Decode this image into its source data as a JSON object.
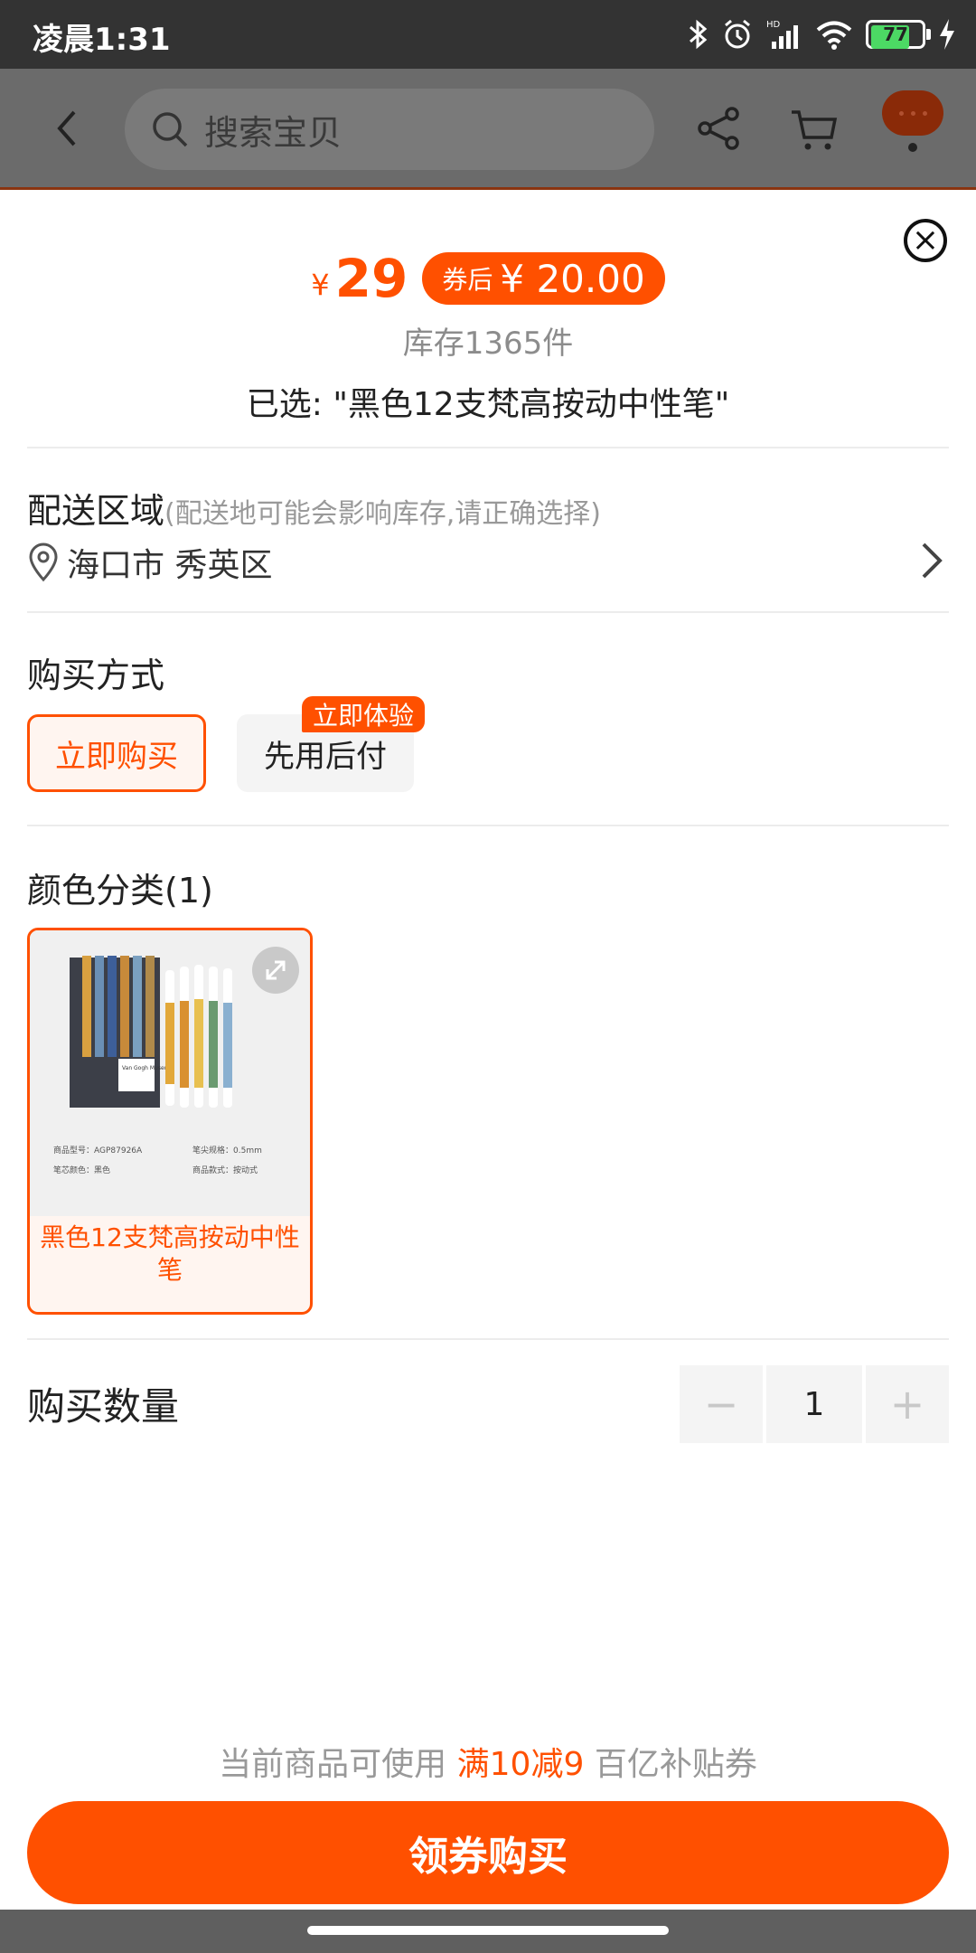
{
  "status_bar": {
    "time": "凌晨1:31",
    "battery_level": "77",
    "icons": [
      "bluetooth-icon",
      "alarm-icon",
      "hd-signal-icon",
      "wifi-icon",
      "battery-icon",
      "charging-icon"
    ]
  },
  "header": {
    "search_placeholder": "搜索宝贝",
    "icons": [
      "back-icon",
      "search-icon",
      "share-icon",
      "cart-icon",
      "more-icon"
    ]
  },
  "product": {
    "currency": "¥",
    "price": "29",
    "coupon_label": "券后",
    "coupon_price": "¥ 20.00",
    "stock": "库存1365件",
    "selected": "已选: \"黑色12支梵高按动中性笔\""
  },
  "delivery": {
    "title": "配送区域",
    "note": "(配送地可能会影响库存,请正确选择)",
    "location": "海口市 秀英区"
  },
  "purchase_method": {
    "title": "购买方式",
    "options": [
      "立即购买",
      "先用后付"
    ],
    "selected": "立即购买",
    "promo_tag": "立即体验"
  },
  "color": {
    "title": "颜色分类(1)",
    "sku_name": "黑色12支梵高按动中性笔",
    "image_text": {
      "museum": "Van Gogh Museum",
      "model_label": "商品型号：AGP87926A",
      "tip_label": "笔尖规格：0.5mm",
      "ink_label": "笔芯颜色：黑色",
      "style_label": "商品款式：按动式"
    }
  },
  "quantity": {
    "title": "购买数量",
    "value": "1",
    "minus": "−",
    "plus": "+"
  },
  "footer": {
    "tip_prefix": "当前商品可使用",
    "tip_highlight": "满10减9",
    "tip_suffix": "百亿补贴券",
    "buy_button": "领券购买"
  },
  "colors": {
    "accent": "#ff5000",
    "status_bar": "#333333",
    "overlay_header": "#6b6b6b"
  }
}
